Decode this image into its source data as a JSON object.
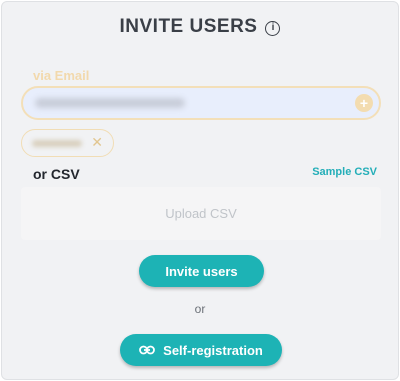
{
  "modal": {
    "title": "INVITE USERS",
    "info_icon": "info-icon"
  },
  "email": {
    "label": "via Email",
    "value": "",
    "add_icon": "plus-icon"
  },
  "chip": {
    "value": "",
    "remove_icon": "close-icon"
  },
  "csv": {
    "label": "or CSV",
    "sample_link": "Sample CSV",
    "upload_text": "Upload CSV"
  },
  "actions": {
    "invite_label": "Invite users",
    "or_text": "or",
    "self_registration_label": "Self-registration",
    "self_registration_icon": "link-icon"
  },
  "colors": {
    "accent": "#1db3b5",
    "email_border": "#f3dfb8",
    "title_text": "#3a3f47"
  }
}
